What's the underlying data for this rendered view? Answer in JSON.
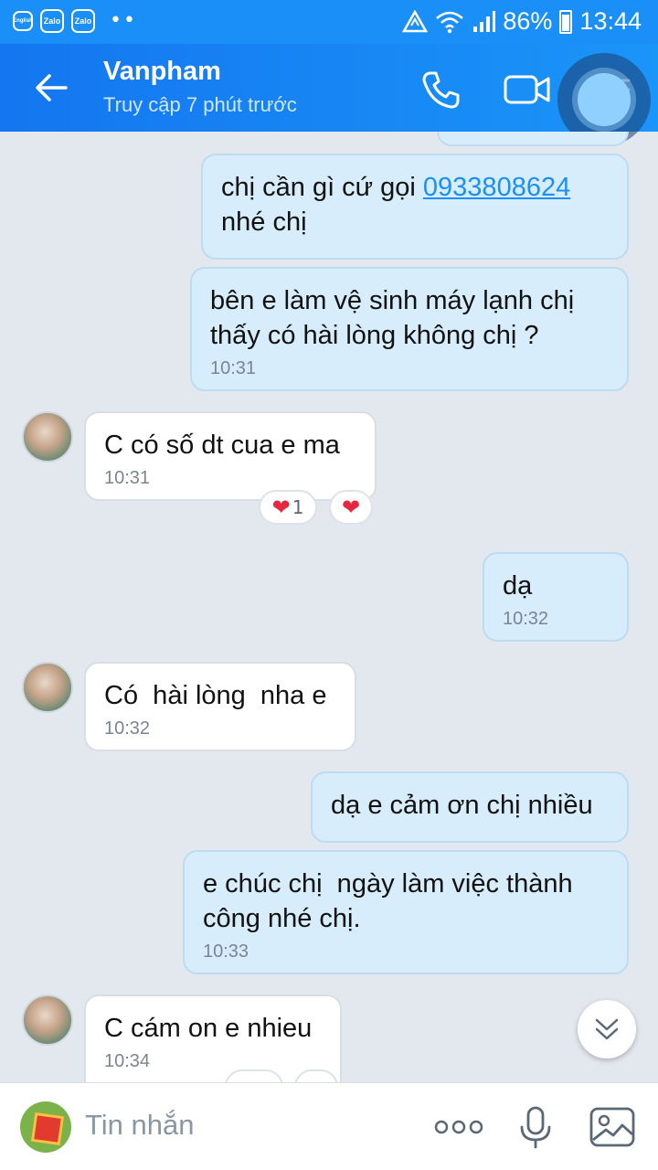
{
  "status_bar": {
    "apps": [
      "English",
      "Zalo",
      "Zalo"
    ],
    "dots": "••",
    "battery": "86%",
    "time": "13:44"
  },
  "header": {
    "name": "Vanpham",
    "last_seen": "Truy cập 7 phút trước",
    "icons": [
      "back-arrow-icon",
      "phone-icon",
      "video-call-icon",
      "menu-icon"
    ]
  },
  "messages": [
    {
      "side": "out",
      "text_before": "chị cần gì cứ gọi ",
      "link": "0933808624",
      "text_after": "nhé chị",
      "time": ""
    },
    {
      "side": "out",
      "text": "bên e làm vệ sinh máy lạnh chị thấy có hài lòng không chị ?",
      "time": "10:31"
    },
    {
      "side": "in",
      "text": "C có số dt cua e ma",
      "time": "10:31",
      "reaction_count": "1"
    },
    {
      "side": "out",
      "text": "dạ",
      "time": "10:32"
    },
    {
      "side": "in",
      "text": "Có  hài lòng  nha e",
      "time": "10:32"
    },
    {
      "side": "out",
      "text": "dạ e cảm ơn chị nhiều",
      "time": ""
    },
    {
      "side": "out",
      "text": "e chúc chị  ngày làm việc thành công nhé chị.",
      "time": "10:33"
    },
    {
      "side": "in",
      "text": "C cám on e nhieu",
      "time": "10:34"
    }
  ],
  "input": {
    "placeholder": "Tin nhắn",
    "icons": [
      "sticker-icon",
      "more-icon",
      "microphone-icon",
      "image-icon"
    ]
  },
  "colors": {
    "header": "#1a8ff7",
    "outgoing_bubble": "#d7edfc",
    "incoming_bubble": "#ffffff",
    "link": "#1a8ff7",
    "heart": "#e8263d"
  }
}
